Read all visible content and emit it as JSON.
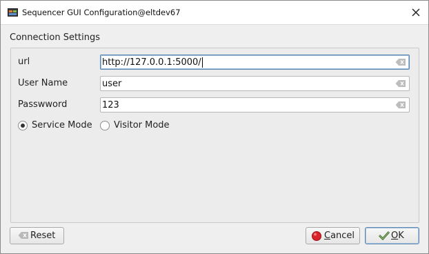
{
  "window": {
    "title": "Sequencer GUI Configuration@eltdev67"
  },
  "group": {
    "title": "Connection Settings"
  },
  "fields": {
    "url": {
      "label": "url",
      "value": "http://127.0.0.1:5000/"
    },
    "username": {
      "label": "User Name",
      "value": "user"
    },
    "password": {
      "label": "Passwword",
      "value": "123"
    }
  },
  "mode": {
    "service_label": "Service Mode",
    "visitor_label": "Visitor Mode",
    "selected": "service"
  },
  "buttons": {
    "reset_label": "Reset",
    "cancel_rest": "ancel",
    "cancel_mnemonic": "C",
    "ok_rest": "K",
    "ok_mnemonic": "O"
  },
  "colors": {
    "cancel_icon": "#d8232a",
    "ok_icon": "#3e6b2a"
  },
  "icons": {
    "app": "app-window-icon",
    "close": "close-icon",
    "clear": "clear-text-icon",
    "reset": "reset-icon",
    "cancel": "cancel-icon",
    "ok": "ok-check-icon"
  }
}
